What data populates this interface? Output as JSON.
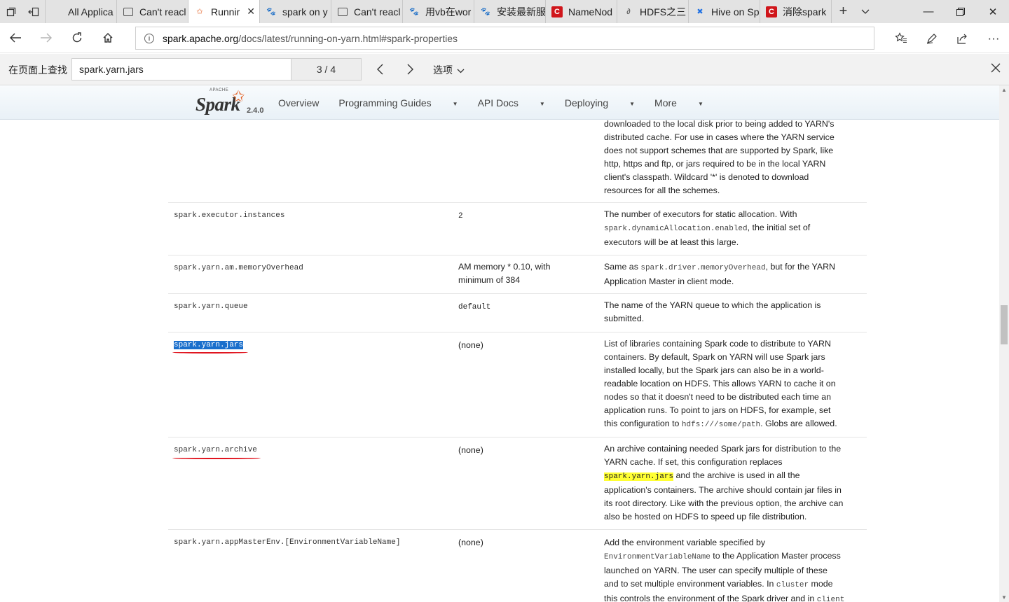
{
  "tabs": [
    {
      "label": "All Applica",
      "icon": "blank"
    },
    {
      "label": "Can't reacl",
      "icon": "document"
    },
    {
      "label": "Runnir",
      "icon": "spark-star",
      "active": true
    },
    {
      "label": "spark on y",
      "icon": "baidu-paw"
    },
    {
      "label": "Can't reacl",
      "icon": "document"
    },
    {
      "label": "用vb在wor",
      "icon": "baidu-paw"
    },
    {
      "label": "安装最新服",
      "icon": "baidu-paw"
    },
    {
      "label": "NameNod",
      "icon": "csdn-c"
    },
    {
      "label": "HDFS之三",
      "icon": "wrench"
    },
    {
      "label": "Hive on Sp",
      "icon": "x-logo"
    },
    {
      "label": "消除spark",
      "icon": "csdn-c"
    }
  ],
  "address": {
    "host": "spark.apache.org",
    "path": "/docs/latest/running-on-yarn.html#spark-properties"
  },
  "find": {
    "label": "在页面上查找",
    "query": "spark.yarn.jars",
    "count": "3 / 4",
    "options_label": "选项"
  },
  "spark_nav": {
    "apache": "APACHE",
    "brand": "Spark",
    "version": "2.4.0",
    "menu": [
      "Overview",
      "Programming Guides",
      "API Docs",
      "Deploying",
      "More"
    ]
  },
  "rows": {
    "r0": {
      "desc": [
        "downloaded to the local disk prior to being added to YARN's",
        "distributed cache. For use in cases where the YARN service",
        "does not support schemes that are supported by Spark, like",
        "http, https and ftp, or jars required to be in the local YARN",
        "client's classpath. Wildcard '*' is denoted to download",
        "resources for all the schemes."
      ]
    },
    "r1": {
      "name": "spark.executor.instances",
      "default": "2",
      "desc1": "The number of executors for static allocation. With",
      "code": "spark.dynamicAllocation.enabled",
      "desc2": ", the initial set of",
      "desc3": "executors will be at least this large."
    },
    "r2": {
      "name": "spark.yarn.am.memoryOverhead",
      "default1": "AM memory * 0.10, with",
      "default2": "minimum of 384",
      "desc1a": "Same as ",
      "code": "spark.driver.memoryOverhead",
      "desc1b": ", but for the YARN",
      "desc2": "Application Master in client mode."
    },
    "r3": {
      "name": "spark.yarn.queue",
      "default": "default",
      "desc1": "The name of the YARN queue to which the application is",
      "desc2": "submitted."
    },
    "r4": {
      "name": "spark.yarn.jars",
      "default": "(none)",
      "desc": [
        "List of libraries containing Spark code to distribute to YARN",
        "containers. By default, Spark on YARN will use Spark jars",
        "installed locally, but the Spark jars can also be in a world-",
        "readable location on HDFS. This allows YARN to cache it on",
        "nodes so that it doesn't need to be distributed each time an",
        "application runs. To point to jars on HDFS, for example, set"
      ],
      "desc_last_a": "this configuration to ",
      "code": "hdfs:///some/path",
      "desc_last_b": ". Globs are allowed."
    },
    "r5": {
      "name": "spark.yarn.archive",
      "default": "(none)",
      "desc1": "An archive containing needed Spark jars for distribution to the",
      "desc2": "YARN cache. If set, this configuration replaces",
      "code": "spark.yarn.jars",
      "desc3b": " and the archive is used in all the",
      "desc4": "application's containers. The archive should contain jar files in",
      "desc5": "its root directory. Like with the previous option, the archive can",
      "desc6": "also be hosted on HDFS to speed up file distribution."
    },
    "r6": {
      "name": "spark.yarn.appMasterEnv.[EnvironmentVariableName]",
      "default": "(none)",
      "desc1": "Add the environment variable specified by",
      "code1": "EnvironmentVariableName",
      "desc2b": " to the Application Master process",
      "desc3": "launched on YARN. The user can specify multiple of these",
      "desc4": "and to set multiple environment variables. In ",
      "code2": "cluster",
      "desc4b": " mode",
      "desc5": "this controls the environment of the Spark driver and in ",
      "code3": "client"
    }
  },
  "colors": {
    "accent_orange": "#e25a1c",
    "find_current": "#1a6fcc",
    "find_match": "#ffff33",
    "annotation_red": "#e0141e"
  }
}
